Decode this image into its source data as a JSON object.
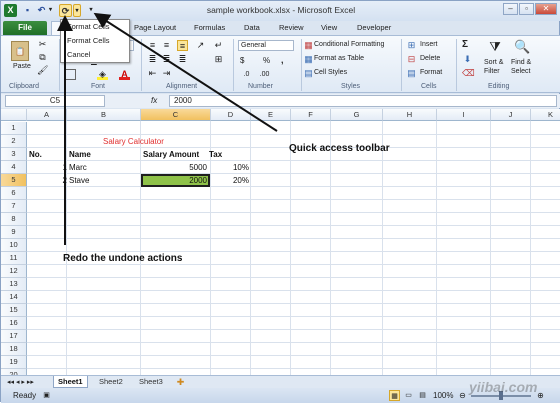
{
  "window": {
    "title": "sample workbook.xlsx - Microsoft Excel"
  },
  "quick_access": {
    "save_icon": "save-icon",
    "undo_icon": "undo-icon",
    "redo_icon": "redo-icon",
    "format_cells_icon": "format-cells-icon",
    "customize_icon": "customize-toolbar-icon"
  },
  "dropdown": {
    "items": [
      "Format Cells",
      "Cancel"
    ]
  },
  "tabs": {
    "file": "File",
    "home": "Home",
    "items": [
      "Page Layout",
      "Formulas",
      "Data",
      "Review",
      "View",
      "Developer"
    ]
  },
  "ribbon": {
    "clipboard": {
      "label": "Clipboard",
      "paste": "Paste"
    },
    "font": {
      "label": "Font"
    },
    "alignment": {
      "label": "Alignment"
    },
    "number": {
      "label": "Number",
      "format": "General",
      "currency": "$",
      "percent": "%",
      "comma": ","
    },
    "styles": {
      "label": "Styles",
      "conditional": "Conditional Formatting",
      "table": "Format as Table",
      "cell": "Cell Styles"
    },
    "cells": {
      "label": "Cells",
      "insert": "Insert",
      "delete": "Delete",
      "format": "Format"
    },
    "editing": {
      "label": "Editing",
      "sigma": "Σ",
      "sort": "Sort &",
      "filter": "Filter",
      "find": "Find &",
      "select": "Select"
    }
  },
  "formula_bar": {
    "name_box": "C5",
    "fx": "fx",
    "value": "2000"
  },
  "grid": {
    "columns": [
      "A",
      "B",
      "C",
      "D",
      "E",
      "F",
      "G",
      "H",
      "I",
      "J",
      "K"
    ],
    "rows": [
      "1",
      "2",
      "3",
      "4",
      "5",
      "6",
      "7",
      "8",
      "9",
      "10",
      "11",
      "12",
      "13",
      "14",
      "15",
      "16",
      "17",
      "18",
      "19",
      "20"
    ],
    "title_cell": "Salary Calculator",
    "headers": {
      "no": "No.",
      "name": "Name",
      "salary": "Salary Amount",
      "tax": "Tax"
    },
    "data": [
      {
        "no": "1",
        "name": "Marc",
        "salary": "5000",
        "tax": "10%"
      },
      {
        "no": "2",
        "name": "Stave",
        "salary": "2000",
        "tax": "20%"
      }
    ]
  },
  "sheets": [
    "Sheet1",
    "Sheet2",
    "Sheet3"
  ],
  "status": {
    "ready": "Ready",
    "zoom": "100%"
  },
  "annotations": {
    "quick_access": "Quick access toolbar",
    "redo": "Redo the undone actions"
  },
  "watermark": "yiibai.com",
  "colors": {
    "file_tab": "#2a7d31",
    "selected_cell_fill": "#8fc249",
    "title_text": "#e03030"
  }
}
